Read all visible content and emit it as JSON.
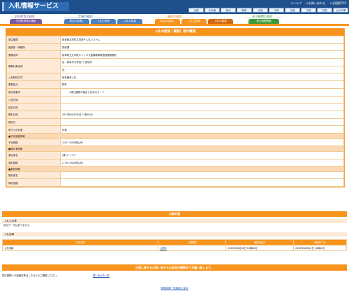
{
  "header": {
    "title": "入札情報サービス",
    "links": [
      "＊ヘルプ",
      "＊お問い合わせ",
      "＊全国版TOP"
    ],
    "regions": [
      "全国",
      "北海道",
      "東北",
      "関東",
      "北陸",
      "中部",
      "近畿",
      "中国",
      "四国",
      "九州沖縄"
    ]
  },
  "nav": {
    "koji": {
      "title": "工事の検索",
      "buttons": [
        "発注の見通し",
        "入札公告等",
        "入札の結果"
      ]
    },
    "gyomu": {
      "title": "業務の検索",
      "buttons": [
        "発注の見通し",
        "入札公告等",
        "入札の結果"
      ]
    },
    "hatchu": {
      "title": "発注機関の検索",
      "buttons": [
        "発注機関情報"
      ]
    },
    "left": {
      "title": "学校教育の検索",
      "buttons": [
        "学校教育発注情報"
      ]
    }
  },
  "detail": {
    "title": "入札の結果（業務）案件概要",
    "rows": [
      {
        "label": "発注機関",
        "value": "岐阜県本村村共同電子入札システム"
      },
      {
        "label": "施設部・事務所",
        "value": "契約課"
      },
      {
        "label": "業務名称",
        "value": "岐阜県五大学院キャンパス整備等事業施設業務委託"
      },
      {
        "label": "業務対象地域",
        "value": "住：岐阜市大学西7丁目地内"
      },
      {
        "label": "",
        "value": "区："
      },
      {
        "label": "入札契約方式",
        "value": "指名競争入札"
      },
      {
        "label": "業務区分",
        "value": "物件"
      },
      {
        "label": "設計書番号",
        "value": "※発注機関が独自に定めるコード"
      },
      {
        "label": "公告日時",
        "value": ""
      },
      {
        "label": "指名日時",
        "value": ""
      },
      {
        "label": "開札日時",
        "value": "2025年06月30日 10時00分"
      },
      {
        "label": "契約日",
        "value": ""
      },
      {
        "label": "電子入札対象",
        "value": "対象"
      }
    ],
    "group1": "■予定価格情報",
    "rows2": [
      {
        "label": "予定価格",
        "value": "3,027,000(税込み)"
      }
    ],
    "group2": "■落札者情報",
    "rows3": [
      {
        "label": "落札者名",
        "value": "(株)テイコク"
      },
      {
        "label": "落札価格",
        "value": "2,750,000(税込み)"
      }
    ],
    "group3": "■契約情報",
    "rows4": [
      {
        "label": "契約者名",
        "value": ""
      },
      {
        "label": "契約金額",
        "value": ""
      }
    ]
  },
  "public_docs": {
    "bar": "公開文書",
    "sub1": "入札公告等",
    "note": "該当データはありません",
    "sub2": "入札結果",
    "headers": [
      "文書名称",
      "公開期間",
      "掲載更新日",
      "掲載終了日"
    ],
    "row": [
      "入札情報",
      "公開中",
      "2025年06月30日 10時00分",
      "2025年08月01日 10時00分"
    ]
  },
  "contact": {
    "bar": "内容に関するお問い合わせは各発注機関までお願い致します。",
    "text": "発注機関への連絡先等はこちらからご確認ください。",
    "link": "問い合せ先一覧"
  },
  "back_link": "検索結果一覧画面に戻る",
  "colors": {
    "header": "#1f4f8c",
    "accent": "#f7941d",
    "label_bg": "#fde9d6"
  }
}
